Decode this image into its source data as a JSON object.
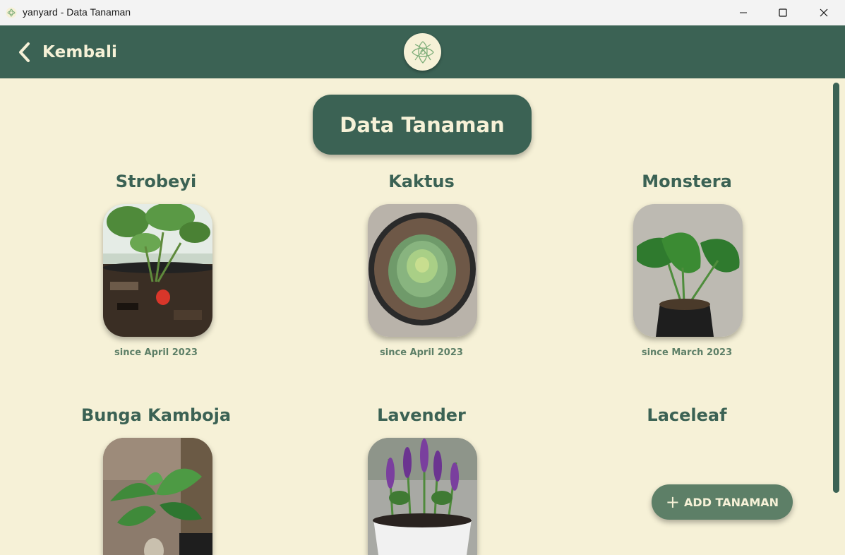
{
  "window": {
    "title": "yanyard - Data Tanaman",
    "controls": [
      "minimize-icon",
      "maximize-icon",
      "close-icon"
    ]
  },
  "header": {
    "back_label": "Kembali",
    "logo_icon": "leaf-logo-icon"
  },
  "page": {
    "title": "Data Tanaman"
  },
  "plants": [
    {
      "name": "Strobeyi",
      "since": "since April 2023",
      "image": "strawberry-plant-photo"
    },
    {
      "name": "Kaktus",
      "since": "since April 2023",
      "image": "succulent-cactus-photo"
    },
    {
      "name": "Monstera",
      "since": "since March 2023",
      "image": "monstera-plant-photo"
    },
    {
      "name": "Bunga Kamboja",
      "since": "",
      "image": "frangipani-plant-photo"
    },
    {
      "name": "Lavender",
      "since": "",
      "image": "lavender-plant-photo"
    },
    {
      "name": "Laceleaf",
      "since": "",
      "image": ""
    }
  ],
  "actions": {
    "add_label": "ADD TANAMAN",
    "add_icon": "plus-icon"
  },
  "colors": {
    "primary": "#3b6254",
    "background": "#f6f1d7",
    "secondary": "#5d7f67"
  }
}
